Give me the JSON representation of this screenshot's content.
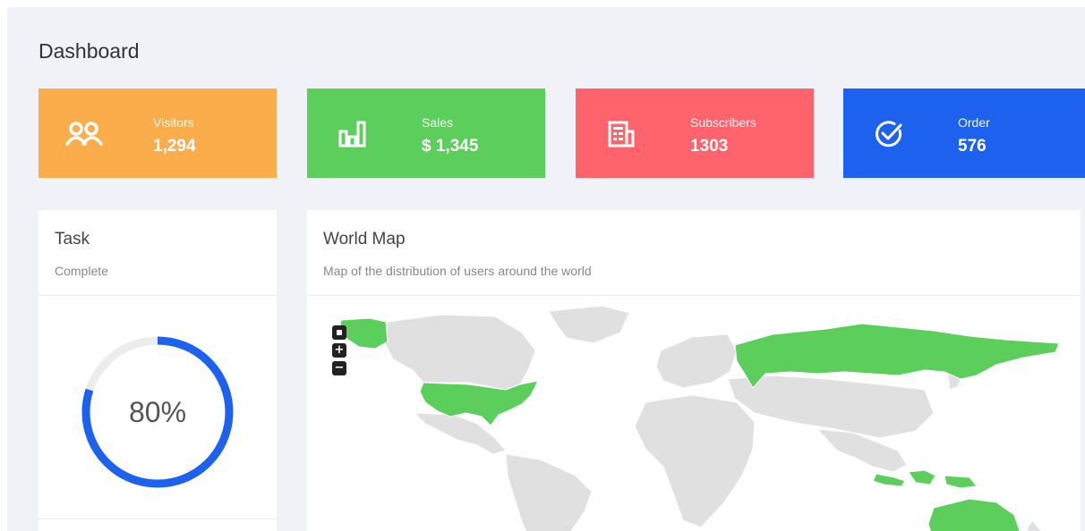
{
  "page": {
    "title": "Dashboard"
  },
  "cards": [
    {
      "label": "Visitors",
      "value": "1,294",
      "icon": "users-icon",
      "color": "#fbac4b"
    },
    {
      "label": "Sales",
      "value": "$ 1,345",
      "icon": "bar-chart-icon",
      "color": "#5cce5c"
    },
    {
      "label": "Subscribers",
      "value": "1303",
      "icon": "newspaper-icon",
      "color": "#ff646c"
    },
    {
      "label": "Order",
      "value": "576",
      "icon": "check-circle-icon",
      "color": "#1d61ef"
    }
  ],
  "task": {
    "title": "Task",
    "subtitle": "Complete",
    "progress_text": "80%",
    "progress": 0.8,
    "ring_color": "#1d61ef"
  },
  "map": {
    "title": "World Map",
    "subtitle": "Map of the distribution of users around the world",
    "highlight_color": "#5cce5c",
    "land_color": "#e0e0e0",
    "highlighted_regions": [
      "United States",
      "Alaska",
      "Russia",
      "Indonesia",
      "Australia"
    ]
  }
}
